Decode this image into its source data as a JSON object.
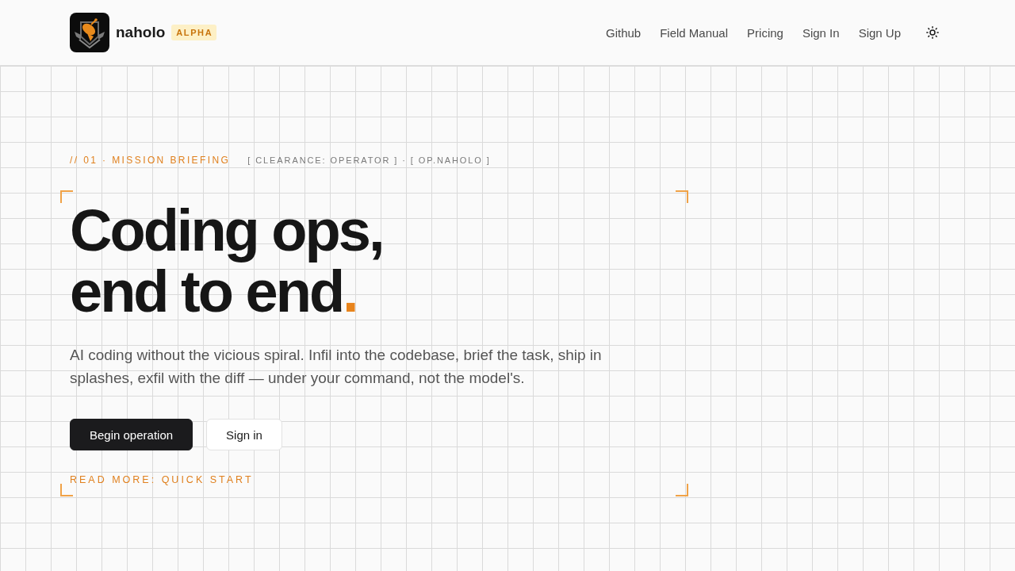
{
  "header": {
    "brand": {
      "name": "naholo",
      "badge": "ALPHA"
    },
    "nav": [
      {
        "label": "Github"
      },
      {
        "label": "Field Manual"
      },
      {
        "label": "Pricing"
      },
      {
        "label": "Sign In"
      },
      {
        "label": "Sign Up"
      }
    ]
  },
  "hero": {
    "eyebrow": {
      "section": "// 01 · MISSION BRIEFING",
      "tags": "[ CLEARANCE: OPERATOR ] · [ OP.NAHOLO ]"
    },
    "headline": {
      "lines": [
        "Coding ops,",
        "end to end"
      ],
      "accent": "."
    },
    "lead": "AI coding without the vicious spiral. Infil into the codebase, brief the task, ship in splashes, exfil with the diff — under your command, not the model's.",
    "buttons": [
      {
        "label": "Begin operation",
        "kind": "primary"
      },
      {
        "label": "Sign in",
        "kind": "secondary"
      }
    ],
    "link": "READ MORE: QUICK START"
  }
}
